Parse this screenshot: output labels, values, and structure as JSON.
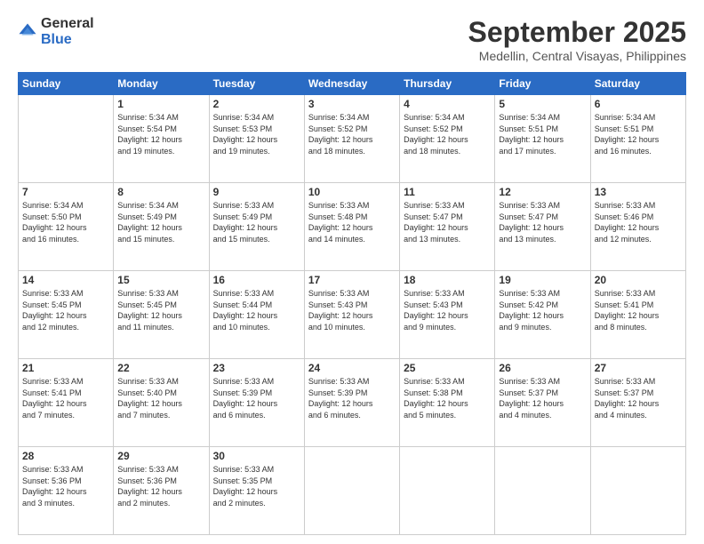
{
  "logo": {
    "general": "General",
    "blue": "Blue"
  },
  "title": "September 2025",
  "location": "Medellin, Central Visayas, Philippines",
  "headers": [
    "Sunday",
    "Monday",
    "Tuesday",
    "Wednesday",
    "Thursday",
    "Friday",
    "Saturday"
  ],
  "weeks": [
    [
      {
        "day": "",
        "sunrise": "",
        "sunset": "",
        "daylight": ""
      },
      {
        "day": "1",
        "sunrise": "Sunrise: 5:34 AM",
        "sunset": "Sunset: 5:54 PM",
        "daylight": "Daylight: 12 hours and 19 minutes."
      },
      {
        "day": "2",
        "sunrise": "Sunrise: 5:34 AM",
        "sunset": "Sunset: 5:53 PM",
        "daylight": "Daylight: 12 hours and 19 minutes."
      },
      {
        "day": "3",
        "sunrise": "Sunrise: 5:34 AM",
        "sunset": "Sunset: 5:52 PM",
        "daylight": "Daylight: 12 hours and 18 minutes."
      },
      {
        "day": "4",
        "sunrise": "Sunrise: 5:34 AM",
        "sunset": "Sunset: 5:52 PM",
        "daylight": "Daylight: 12 hours and 18 minutes."
      },
      {
        "day": "5",
        "sunrise": "Sunrise: 5:34 AM",
        "sunset": "Sunset: 5:51 PM",
        "daylight": "Daylight: 12 hours and 17 minutes."
      },
      {
        "day": "6",
        "sunrise": "Sunrise: 5:34 AM",
        "sunset": "Sunset: 5:51 PM",
        "daylight": "Daylight: 12 hours and 16 minutes."
      }
    ],
    [
      {
        "day": "7",
        "sunrise": "Sunrise: 5:34 AM",
        "sunset": "Sunset: 5:50 PM",
        "daylight": "Daylight: 12 hours and 16 minutes."
      },
      {
        "day": "8",
        "sunrise": "Sunrise: 5:34 AM",
        "sunset": "Sunset: 5:49 PM",
        "daylight": "Daylight: 12 hours and 15 minutes."
      },
      {
        "day": "9",
        "sunrise": "Sunrise: 5:33 AM",
        "sunset": "Sunset: 5:49 PM",
        "daylight": "Daylight: 12 hours and 15 minutes."
      },
      {
        "day": "10",
        "sunrise": "Sunrise: 5:33 AM",
        "sunset": "Sunset: 5:48 PM",
        "daylight": "Daylight: 12 hours and 14 minutes."
      },
      {
        "day": "11",
        "sunrise": "Sunrise: 5:33 AM",
        "sunset": "Sunset: 5:47 PM",
        "daylight": "Daylight: 12 hours and 13 minutes."
      },
      {
        "day": "12",
        "sunrise": "Sunrise: 5:33 AM",
        "sunset": "Sunset: 5:47 PM",
        "daylight": "Daylight: 12 hours and 13 minutes."
      },
      {
        "day": "13",
        "sunrise": "Sunrise: 5:33 AM",
        "sunset": "Sunset: 5:46 PM",
        "daylight": "Daylight: 12 hours and 12 minutes."
      }
    ],
    [
      {
        "day": "14",
        "sunrise": "Sunrise: 5:33 AM",
        "sunset": "Sunset: 5:45 PM",
        "daylight": "Daylight: 12 hours and 12 minutes."
      },
      {
        "day": "15",
        "sunrise": "Sunrise: 5:33 AM",
        "sunset": "Sunset: 5:45 PM",
        "daylight": "Daylight: 12 hours and 11 minutes."
      },
      {
        "day": "16",
        "sunrise": "Sunrise: 5:33 AM",
        "sunset": "Sunset: 5:44 PM",
        "daylight": "Daylight: 12 hours and 10 minutes."
      },
      {
        "day": "17",
        "sunrise": "Sunrise: 5:33 AM",
        "sunset": "Sunset: 5:43 PM",
        "daylight": "Daylight: 12 hours and 10 minutes."
      },
      {
        "day": "18",
        "sunrise": "Sunrise: 5:33 AM",
        "sunset": "Sunset: 5:43 PM",
        "daylight": "Daylight: 12 hours and 9 minutes."
      },
      {
        "day": "19",
        "sunrise": "Sunrise: 5:33 AM",
        "sunset": "Sunset: 5:42 PM",
        "daylight": "Daylight: 12 hours and 9 minutes."
      },
      {
        "day": "20",
        "sunrise": "Sunrise: 5:33 AM",
        "sunset": "Sunset: 5:41 PM",
        "daylight": "Daylight: 12 hours and 8 minutes."
      }
    ],
    [
      {
        "day": "21",
        "sunrise": "Sunrise: 5:33 AM",
        "sunset": "Sunset: 5:41 PM",
        "daylight": "Daylight: 12 hours and 7 minutes."
      },
      {
        "day": "22",
        "sunrise": "Sunrise: 5:33 AM",
        "sunset": "Sunset: 5:40 PM",
        "daylight": "Daylight: 12 hours and 7 minutes."
      },
      {
        "day": "23",
        "sunrise": "Sunrise: 5:33 AM",
        "sunset": "Sunset: 5:39 PM",
        "daylight": "Daylight: 12 hours and 6 minutes."
      },
      {
        "day": "24",
        "sunrise": "Sunrise: 5:33 AM",
        "sunset": "Sunset: 5:39 PM",
        "daylight": "Daylight: 12 hours and 6 minutes."
      },
      {
        "day": "25",
        "sunrise": "Sunrise: 5:33 AM",
        "sunset": "Sunset: 5:38 PM",
        "daylight": "Daylight: 12 hours and 5 minutes."
      },
      {
        "day": "26",
        "sunrise": "Sunrise: 5:33 AM",
        "sunset": "Sunset: 5:37 PM",
        "daylight": "Daylight: 12 hours and 4 minutes."
      },
      {
        "day": "27",
        "sunrise": "Sunrise: 5:33 AM",
        "sunset": "Sunset: 5:37 PM",
        "daylight": "Daylight: 12 hours and 4 minutes."
      }
    ],
    [
      {
        "day": "28",
        "sunrise": "Sunrise: 5:33 AM",
        "sunset": "Sunset: 5:36 PM",
        "daylight": "Daylight: 12 hours and 3 minutes."
      },
      {
        "day": "29",
        "sunrise": "Sunrise: 5:33 AM",
        "sunset": "Sunset: 5:36 PM",
        "daylight": "Daylight: 12 hours and 2 minutes."
      },
      {
        "day": "30",
        "sunrise": "Sunrise: 5:33 AM",
        "sunset": "Sunset: 5:35 PM",
        "daylight": "Daylight: 12 hours and 2 minutes."
      },
      {
        "day": "",
        "sunrise": "",
        "sunset": "",
        "daylight": ""
      },
      {
        "day": "",
        "sunrise": "",
        "sunset": "",
        "daylight": ""
      },
      {
        "day": "",
        "sunrise": "",
        "sunset": "",
        "daylight": ""
      },
      {
        "day": "",
        "sunrise": "",
        "sunset": "",
        "daylight": ""
      }
    ]
  ]
}
